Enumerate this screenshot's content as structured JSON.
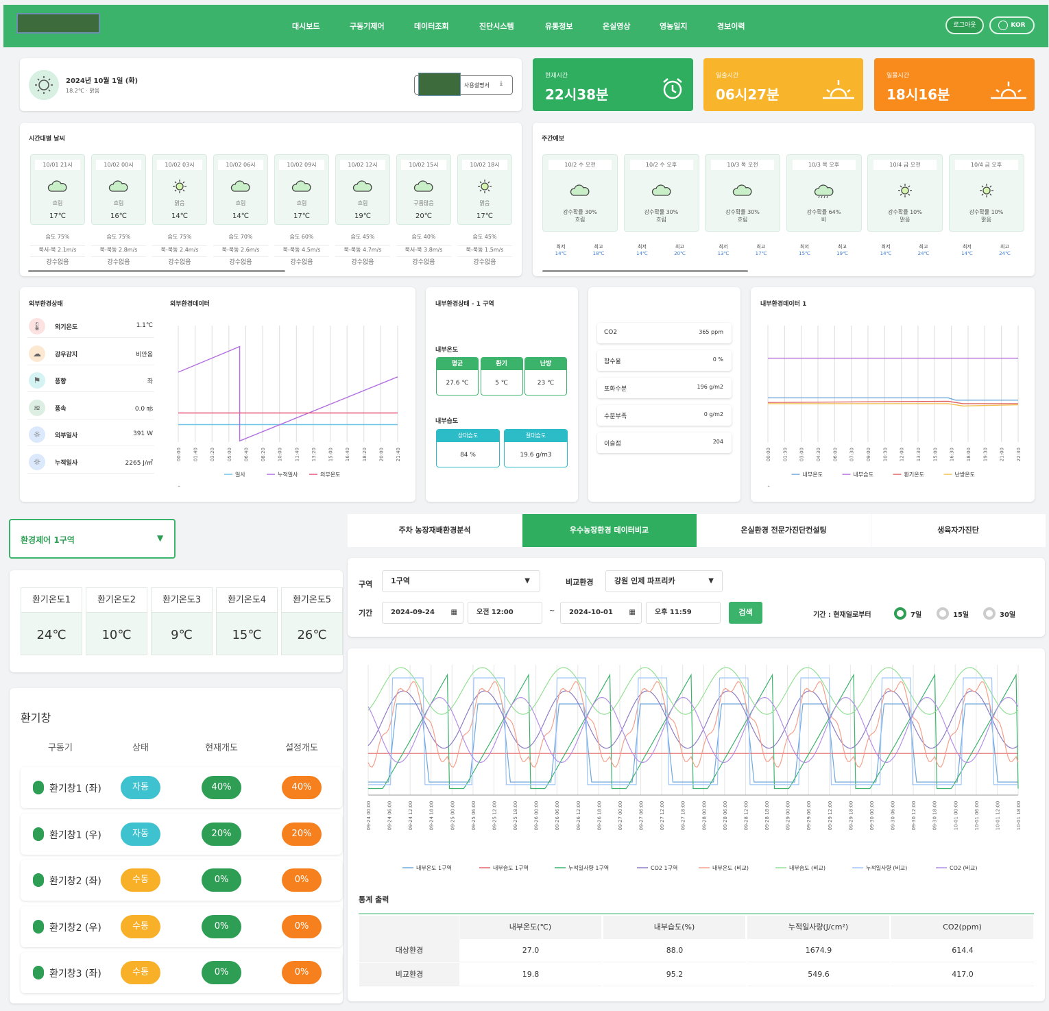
{
  "nav": {
    "items": [
      "대시보드",
      "구동기제어",
      "데이터조회",
      "진단시스템",
      "유통정보",
      "온실영상",
      "영농일지",
      "경보이력"
    ],
    "logout": "로그아웃",
    "lang": "KOR"
  },
  "today": {
    "date": "2024년 10월 1일 (화)",
    "sub": "18.2℃ · 맑음",
    "manual": "사용설명서"
  },
  "time_cards": [
    {
      "label": "현재시간",
      "value": "22시38분",
      "icon": "alarm-clock-icon"
    },
    {
      "label": "일출시간",
      "value": "06시27분",
      "icon": "sunrise-icon"
    },
    {
      "label": "일몰시간",
      "value": "18시16분",
      "icon": "sunset-icon"
    }
  ],
  "hourly": {
    "title": "시간대별 날씨",
    "items": [
      {
        "time": "10/01 21시",
        "icon": "cloud-icon",
        "cond": "흐림",
        "temp": "17℃",
        "hum": "습도 75%",
        "wind": "북서-북 2.1m/s",
        "rain": "강수없음"
      },
      {
        "time": "10/02 00시",
        "icon": "cloud-icon",
        "cond": "흐림",
        "temp": "16℃",
        "hum": "습도 75%",
        "wind": "북-북동 2.8m/s",
        "rain": "강수없음"
      },
      {
        "time": "10/02 03시",
        "icon": "sun-icon",
        "cond": "맑음",
        "temp": "14℃",
        "hum": "습도 75%",
        "wind": "북-북동 2.4m/s",
        "rain": "강수없음"
      },
      {
        "time": "10/02 06시",
        "icon": "cloud-icon",
        "cond": "흐림",
        "temp": "14℃",
        "hum": "습도 70%",
        "wind": "북-북동 2.6m/s",
        "rain": "강수없음"
      },
      {
        "time": "10/02 09시",
        "icon": "cloud-icon",
        "cond": "흐림",
        "temp": "17℃",
        "hum": "습도 60%",
        "wind": "북-북동 4.5m/s",
        "rain": "강수없음"
      },
      {
        "time": "10/02 12시",
        "icon": "cloud-icon",
        "cond": "흐림",
        "temp": "19℃",
        "hum": "습도 45%",
        "wind": "북-북동 4.7m/s",
        "rain": "강수없음"
      },
      {
        "time": "10/02 15시",
        "icon": "cloud-icon",
        "cond": "구름많음",
        "temp": "20℃",
        "hum": "습도 40%",
        "wind": "북서-북 3.8m/s",
        "rain": "강수없음"
      },
      {
        "time": "10/02 18시",
        "icon": "sun-icon",
        "cond": "맑음",
        "temp": "17℃",
        "hum": "습도 45%",
        "wind": "북-북동 1.5m/s",
        "rain": "강수없음"
      }
    ]
  },
  "weekly": {
    "title": "주간예보",
    "min_label": "최저",
    "max_label": "최고",
    "items": [
      {
        "day": "10/2 수 오전",
        "icon": "cloud-icon",
        "rain": "강수확률 30%",
        "cond": "흐림",
        "min": "14℃",
        "max": "18℃"
      },
      {
        "day": "10/2 수 오후",
        "icon": "cloud-icon",
        "rain": "강수확률 30%",
        "cond": "흐림",
        "min": "14℃",
        "max": "20℃"
      },
      {
        "day": "10/3 목 오전",
        "icon": "cloud-icon",
        "rain": "강수확률 30%",
        "cond": "흐림",
        "min": "13℃",
        "max": "17℃"
      },
      {
        "day": "10/3 목 오후",
        "icon": "rain-icon",
        "rain": "강수확률 64%",
        "cond": "비",
        "min": "15℃",
        "max": "19℃"
      },
      {
        "day": "10/4 금 오전",
        "icon": "sun-icon",
        "rain": "강수확률 10%",
        "cond": "맑음",
        "min": "14℃",
        "max": "24℃"
      },
      {
        "day": "10/4 금 오후",
        "icon": "sun-icon",
        "rain": "강수확률 10%",
        "cond": "맑음",
        "min": "14℃",
        "max": "24℃"
      }
    ]
  },
  "ext_status": {
    "title": "외부환경상태",
    "items": [
      {
        "name": "외기온도",
        "value": "1.1℃",
        "icon": "thermometer-icon",
        "color": "#fde2e2"
      },
      {
        "name": "강우감지",
        "value": "비안옴",
        "icon": "rain-cloud-icon",
        "color": "#fde9d2"
      },
      {
        "name": "풍향",
        "value": "좌",
        "icon": "flag-icon",
        "color": "#d6f3f3"
      },
      {
        "name": "풍속",
        "value": "0.0 ㎧",
        "icon": "wind-icon",
        "color": "#dcefe2"
      },
      {
        "name": "외부일사",
        "value": "391 W",
        "icon": "sun-icon",
        "color": "#dce8fb"
      },
      {
        "name": "누적일사",
        "value": "2265 J/㎡",
        "icon": "sun-icon",
        "color": "#dce8fb"
      }
    ]
  },
  "ext_chart": {
    "title": "외부환경데이터",
    "x": [
      "00:00",
      "01:40",
      "03:20",
      "05:00",
      "06:40",
      "08:20",
      "10:00",
      "11:40",
      "13:20",
      "15:00",
      "16:40",
      "18:20",
      "20:00",
      "21:40"
    ],
    "legend": [
      "일사",
      "누적일사",
      "외부온도"
    ]
  },
  "int_status": {
    "title": "내부환경상태 - 1 구역",
    "temp_label": "내부온도",
    "temps": [
      {
        "h": "평균",
        "v": "27.6 ℃"
      },
      {
        "h": "환기",
        "v": "5 ℃"
      },
      {
        "h": "난방",
        "v": "23 ℃"
      }
    ],
    "hum_label": "내부습도",
    "hums": [
      {
        "h": "상대습도",
        "v": "84 %"
      },
      {
        "h": "절대습도",
        "v": "19.6 g/m3"
      }
    ]
  },
  "sensors": [
    {
      "name": "CO2",
      "value": "365 ppm"
    },
    {
      "name": "함수율",
      "value": "0 %"
    },
    {
      "name": "포화수분",
      "value": "196 g/m2"
    },
    {
      "name": "수분부족",
      "value": "0 g/m2"
    },
    {
      "name": "이슬점",
      "value": "204"
    }
  ],
  "int_chart": {
    "title": "내부환경데이터 1",
    "x": [
      "00:00",
      "01:30",
      "03:00",
      "04:30",
      "06:00",
      "07:30",
      "09:00",
      "10:30",
      "12:00",
      "13:30",
      "15:00",
      "16:30",
      "18:00",
      "19:30",
      "21:00",
      "22:30"
    ],
    "legend": [
      "내부온도",
      "내부습도",
      "환기온도",
      "난방온도"
    ]
  },
  "zone_select": {
    "value": "환경제어 1구역"
  },
  "tabs": [
    "주차 농장재배환경분석",
    "우수농장환경 데이터비교",
    "온실환경 전문가진단컨설팅",
    "생육자가진단"
  ],
  "vent_temps": [
    {
      "h": "환기온도1",
      "v": "24℃"
    },
    {
      "h": "환기온도2",
      "v": "10℃"
    },
    {
      "h": "환기온도3",
      "v": "9℃"
    },
    {
      "h": "환기온도4",
      "v": "15℃"
    },
    {
      "h": "환기온도5",
      "v": "26℃"
    }
  ],
  "vents": {
    "title": "환기창",
    "headers": [
      "구동기",
      "상태",
      "현재개도",
      "설정개도"
    ],
    "rows": [
      {
        "name": "환기창1 (좌)",
        "state": "자동",
        "state_color": "#3fc2cf",
        "cur": "40%",
        "set": "40%"
      },
      {
        "name": "환기창1 (우)",
        "state": "자동",
        "state_color": "#3fc2cf",
        "cur": "20%",
        "set": "20%"
      },
      {
        "name": "환기창2 (좌)",
        "state": "수동",
        "state_color": "#f7b027",
        "cur": "0%",
        "set": "0%"
      },
      {
        "name": "환기창2 (우)",
        "state": "수동",
        "state_color": "#f7b027",
        "cur": "0%",
        "set": "0%"
      },
      {
        "name": "환기창3 (좌)",
        "state": "수동",
        "state_color": "#f7b027",
        "cur": "0%",
        "set": "0%"
      }
    ]
  },
  "filter": {
    "zone_label": "구역",
    "zone": "1구역",
    "compare_label": "비교환경",
    "compare": "강원 인제 파프리카",
    "period_label": "기간",
    "start_date": "2024-09-24",
    "start_time": "오전 12:00",
    "tilde": "~",
    "end_date": "2024-10-01",
    "end_time": "오후 11:59",
    "search": "검색",
    "range_label": "기간 : 현재일로부터",
    "ranges": [
      "7일",
      "15일",
      "30일"
    ]
  },
  "compare_chart": {
    "x": [
      "09-24 00:00",
      "09-24 06:00",
      "09-24 12:00",
      "09-24 18:00",
      "09-25 00:00",
      "09-25 06:00",
      "09-25 12:00",
      "09-25 18:00",
      "09-26 00:00",
      "09-26 06:00",
      "09-26 12:00",
      "09-26 18:00",
      "09-27 00:00",
      "09-27 06:00",
      "09-27 12:00",
      "09-27 18:00",
      "09-28 00:00",
      "09-28 06:00",
      "09-28 12:00",
      "09-28 18:00",
      "09-29 00:00",
      "09-29 06:00",
      "09-29 12:00",
      "09-29 18:00",
      "09-30 00:00",
      "09-30 06:00",
      "09-30 12:00",
      "09-30 18:00",
      "10-01 00:00",
      "10-01 06:00",
      "10-01 12:00",
      "10-01 18:00"
    ],
    "legend": [
      {
        "name": "내부온도 1구역",
        "color": "#6fa8dc"
      },
      {
        "name": "내부습도 1구역",
        "color": "#e06666"
      },
      {
        "name": "누적일사량 1구역",
        "color": "#3bb36a"
      },
      {
        "name": "CO2 1구역",
        "color": "#8e7cc3"
      },
      {
        "name": "내부온도 (비교)",
        "color": "#f4a08a"
      },
      {
        "name": "내부습도 (비교)",
        "color": "#93e093"
      },
      {
        "name": "누적일사량 (비교)",
        "color": "#9fc5f8"
      },
      {
        "name": "CO2 (비교)",
        "color": "#b48ee8"
      }
    ]
  },
  "stats": {
    "title": "통계 출력",
    "headers": [
      "",
      "내부온도(℃)",
      "내부습도(%)",
      "누적일사량(J/cm²)",
      "CO2(ppm)"
    ],
    "rows": [
      [
        "대상환경",
        "27.0",
        "88.0",
        "1674.9",
        "614.4"
      ],
      [
        "비교환경",
        "19.8",
        "95.2",
        "549.6",
        "417.0"
      ]
    ]
  }
}
